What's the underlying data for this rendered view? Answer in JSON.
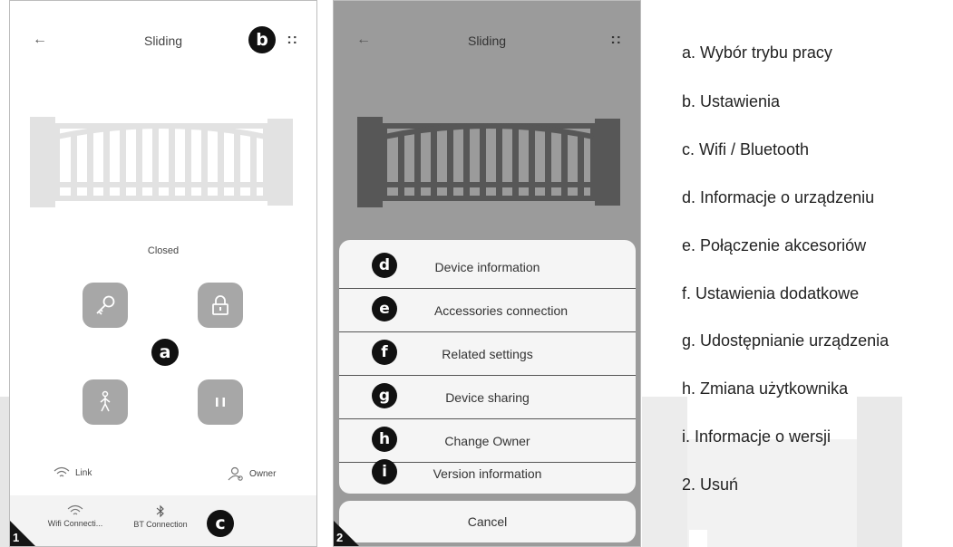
{
  "phone1": {
    "title": "Sliding",
    "back": "←",
    "menu": "::",
    "status": "Closed",
    "link_label": "Link",
    "owner_label": "Owner",
    "tabs": [
      {
        "label": "Wifi Connecti...",
        "icon": "wifi-icon"
      },
      {
        "label": "BT Connection",
        "icon": "bluetooth-icon"
      }
    ],
    "badge_a": "a",
    "badge_b": "b",
    "badge_c": "c",
    "corner_number": "1"
  },
  "phone2": {
    "title": "Sliding",
    "back": "←",
    "menu": "::",
    "menu_items": [
      {
        "badge": "d",
        "label": "Device information"
      },
      {
        "badge": "e",
        "label": "Accessories connection"
      },
      {
        "badge": "f",
        "label": "Related settings"
      },
      {
        "badge": "g",
        "label": "Device sharing"
      },
      {
        "badge": "h",
        "label": "Change Owner"
      },
      {
        "badge": "i",
        "label": "Version information"
      }
    ],
    "cancel": "Cancel",
    "corner_number": "2"
  },
  "legend": [
    "a. Wybór trybu pracy",
    "b. Ustawienia",
    "c. Wifi / Bluetooth",
    "d. Informacje o urządzeniu",
    "e. Połączenie akcesoriów",
    "f. Ustawienia dodatkowe",
    "g. Udostępnianie urządzenia",
    "h. Zmiana użytkownika",
    "i. Informacje o wersji",
    "2. Usuń"
  ],
  "colors": {
    "badge": "#111111",
    "control": "#a7a7a7",
    "gate_light": "#e2e2e2",
    "gate_dark": "#575757",
    "overlay": "#9b9b9b"
  }
}
